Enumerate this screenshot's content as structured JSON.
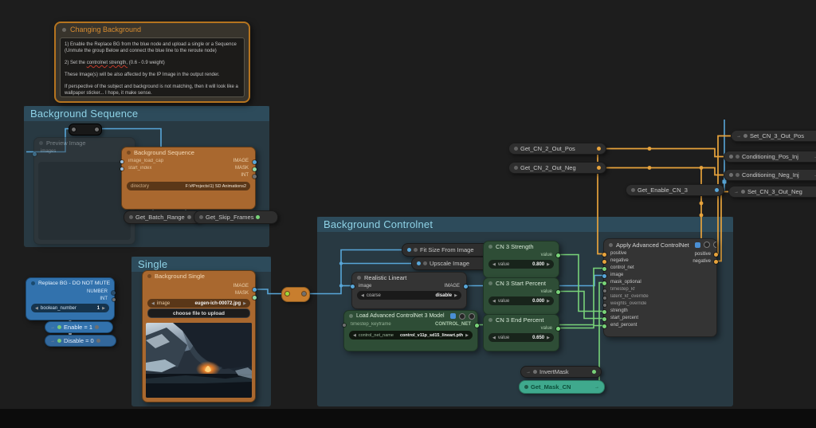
{
  "note": {
    "title": "Changing Background",
    "line1": "1) Enable the Replace BG from the blue node and upload a single or a Sequence (Unmute the group Below and connect the blue line to the reroute node)",
    "line2_pre": "2) Set the ",
    "line2_word1": "controlnet",
    "line2_mid": " ",
    "line2_word2": "strength,",
    "line2_post": " (0.6 - 0.9 weight)",
    "line3": "These Image(s) will be also affected by the IP Image in the output render.",
    "line4": "If perspective of the subject and background is not matching, then it will look like a wallpaper sticker... I hope, it make sense."
  },
  "groups": {
    "sequence": "Background Sequence",
    "single": "Single",
    "controlnet": "Background Controlnet"
  },
  "colors": {
    "wire_blue": "#58a6d8",
    "wire_orange": "#e7a33c",
    "wire_green": "#79d379",
    "group_fill": "#3e708a",
    "node_orange": "#a9682f",
    "node_green": "#2e4d36",
    "node_blue": "#3272ad"
  },
  "nodes": {
    "preview": {
      "title": "Preview Image",
      "input": "images"
    },
    "bgseq": {
      "title": "Background Sequence",
      "in1": "image_load_cap",
      "in2": "start_index",
      "out1": "IMAGE",
      "out2": "MASK",
      "out3": "INT",
      "widget_label": "directory",
      "widget_value": "F:\\#Projects\\1) SD Animations2"
    },
    "get_batch": {
      "title": "Get_Batch_Range"
    },
    "get_skip": {
      "title": "Get_Skip_Frames"
    },
    "replace": {
      "title": "Replace BG - DO NOT MUTE",
      "out1": "NUMBER",
      "out2": "INT",
      "widget_label": "boolean_number",
      "widget_value": "1"
    },
    "enable": {
      "title": "Enable = 1"
    },
    "disable": {
      "title": "Disable = 0"
    },
    "bgsingle": {
      "title": "Background Single",
      "out1": "IMAGE",
      "out2": "MASK",
      "widget_label": "image",
      "widget_value": "eugen-ich-00072.jpg",
      "button": "choose file to upload"
    },
    "fitsize": {
      "title": "Fit Size From Image"
    },
    "upscale": {
      "title": "Upscale Image"
    },
    "lineart": {
      "title": "Realistic Lineart",
      "in1": "image",
      "out1": "IMAGE",
      "widget_label": "coarse",
      "widget_value": "disable"
    },
    "loadcn": {
      "title": "Load Advanced ControlNet 3 Model",
      "in1": "timestep_keyframe",
      "out1": "CONTROL_NET",
      "widget_label": "control_net_name",
      "widget_value": "control_v11p_sd15_lineart.pth"
    },
    "cn_strength": {
      "title": "CN 3 Strength",
      "out1": "value",
      "widget_label": "value",
      "widget_value": "0.800"
    },
    "cn_start": {
      "title": "CN 3 Start Percent",
      "out1": "value",
      "widget_label": "value",
      "widget_value": "0.000"
    },
    "cn_end": {
      "title": "CN 3 End Percent",
      "out1": "value",
      "widget_label": "value",
      "widget_value": "0.650"
    },
    "apply": {
      "title": "Apply Advanced ControlNet",
      "inputs": [
        "positive",
        "negative",
        "control_net",
        "image",
        "mask_optional",
        "timestep_kf",
        "latent_kf_override",
        "weights_override",
        "strength",
        "start_percent",
        "end_percent"
      ],
      "out1": "positive",
      "out2": "negative"
    },
    "invertmask": {
      "title": "InvertMask"
    },
    "getmask": {
      "title": "Get_Mask_CN"
    },
    "getcn2pos": {
      "title": "Get_CN_2_Out_Pos"
    },
    "getcn2neg": {
      "title": "Get_CN_2_Out_Neg"
    },
    "getenable": {
      "title": "Get_Enable_CN_3"
    },
    "setpos": {
      "title": "Set_CN_3_Out_Pos"
    },
    "condpos": {
      "title": "Conditioning_Pos_Inj"
    },
    "condneg": {
      "title": "Conditioning_Neg_Inj"
    },
    "setneg": {
      "title": "Set_CN_3_Out_Neg"
    }
  }
}
